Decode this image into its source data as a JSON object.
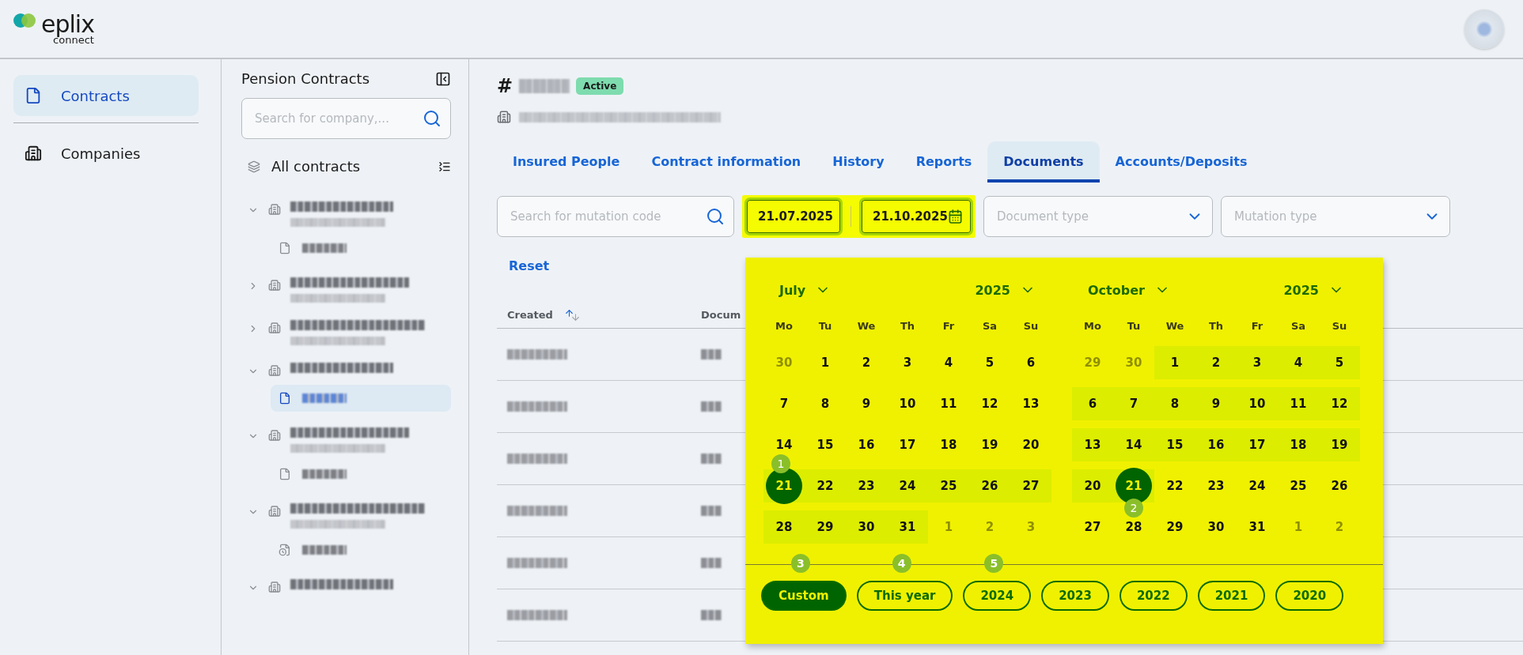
{
  "brand": {
    "name": "eplix",
    "tagline": "connect"
  },
  "nav": [
    {
      "label": "Contracts",
      "selected": true
    },
    {
      "label": "Companies",
      "selected": false
    }
  ],
  "tree_panel": {
    "title": "Pension Contracts",
    "search": {
      "placeholder": "Search for company,..."
    },
    "root": {
      "label": "All contracts"
    },
    "items": [
      {
        "expanded": true,
        "subline": true,
        "children": [
          {
            "kind": "contract",
            "selected": false
          }
        ]
      },
      {
        "expanded": false,
        "subline": true
      },
      {
        "expanded": false,
        "subline": true
      },
      {
        "expanded": true,
        "subline": false,
        "children": [
          {
            "kind": "contract",
            "selected": true
          }
        ]
      },
      {
        "expanded": true,
        "subline": true,
        "children": [
          {
            "kind": "contract",
            "selected": false
          }
        ]
      },
      {
        "expanded": true,
        "subline": true,
        "children": [
          {
            "kind": "pending",
            "selected": false
          }
        ]
      },
      {
        "expanded": true,
        "subline": false
      }
    ]
  },
  "contract": {
    "number_prefix": "#",
    "status": "Active"
  },
  "tabs": [
    {
      "label": "Insured People",
      "selected": false
    },
    {
      "label": "Contract information",
      "selected": false
    },
    {
      "label": "History",
      "selected": false
    },
    {
      "label": "Reports",
      "selected": false
    },
    {
      "label": "Documents",
      "selected": true
    },
    {
      "label": "Accounts/Deposits",
      "selected": false
    }
  ],
  "filters": {
    "search": {
      "placeholder": "Search for mutation code"
    },
    "date_from": {
      "value": "21.07.2025"
    },
    "date_to": {
      "value": "21.10.2025"
    },
    "document_type": {
      "placeholder": "Document type"
    },
    "mutation_type": {
      "placeholder": "Mutation type"
    },
    "reset": "Reset"
  },
  "table": {
    "columns": [
      {
        "label": "Created",
        "sortable": true
      },
      {
        "label": "Docum",
        "sortable": false
      }
    ],
    "rows": [
      {
        "kind": "redacted"
      },
      {
        "kind": "redacted"
      },
      {
        "kind": "redacted"
      },
      {
        "kind": "redacted"
      },
      {
        "kind": "redacted"
      },
      {
        "kind": "redacted"
      }
    ]
  },
  "date_picker": {
    "months": [
      {
        "month": "July",
        "year": "2025",
        "weekdays": [
          "Mo",
          "Tu",
          "We",
          "Th",
          "Fr",
          "Sa",
          "Su"
        ],
        "weeks": [
          [
            {
              "d": "30",
              "outside": true,
              "in_range": false,
              "selected": false
            },
            {
              "d": "1",
              "outside": false,
              "in_range": false,
              "selected": false
            },
            {
              "d": "2",
              "outside": false,
              "in_range": false,
              "selected": false
            },
            {
              "d": "3",
              "outside": false,
              "in_range": false,
              "selected": false
            },
            {
              "d": "4",
              "outside": false,
              "in_range": false,
              "selected": false
            },
            {
              "d": "5",
              "outside": false,
              "in_range": false,
              "selected": false
            },
            {
              "d": "6",
              "outside": false,
              "in_range": false,
              "selected": false
            }
          ],
          [
            {
              "d": "7",
              "outside": false,
              "in_range": false,
              "selected": false
            },
            {
              "d": "8",
              "outside": false,
              "in_range": false,
              "selected": false
            },
            {
              "d": "9",
              "outside": false,
              "in_range": false,
              "selected": false
            },
            {
              "d": "10",
              "outside": false,
              "in_range": false,
              "selected": false
            },
            {
              "d": "11",
              "outside": false,
              "in_range": false,
              "selected": false
            },
            {
              "d": "12",
              "outside": false,
              "in_range": false,
              "selected": false
            },
            {
              "d": "13",
              "outside": false,
              "in_range": false,
              "selected": false
            }
          ],
          [
            {
              "d": "14",
              "outside": false,
              "in_range": false,
              "selected": false
            },
            {
              "d": "15",
              "outside": false,
              "in_range": false,
              "selected": false
            },
            {
              "d": "16",
              "outside": false,
              "in_range": false,
              "selected": false
            },
            {
              "d": "17",
              "outside": false,
              "in_range": false,
              "selected": false
            },
            {
              "d": "18",
              "outside": false,
              "in_range": false,
              "selected": false
            },
            {
              "d": "19",
              "outside": false,
              "in_range": false,
              "selected": false
            },
            {
              "d": "20",
              "outside": false,
              "in_range": false,
              "selected": false
            }
          ],
          [
            {
              "d": "21",
              "outside": false,
              "in_range": true,
              "selected": true,
              "marker": "1"
            },
            {
              "d": "22",
              "outside": false,
              "in_range": true,
              "selected": false
            },
            {
              "d": "23",
              "outside": false,
              "in_range": true,
              "selected": false
            },
            {
              "d": "24",
              "outside": false,
              "in_range": true,
              "selected": false
            },
            {
              "d": "25",
              "outside": false,
              "in_range": true,
              "selected": false
            },
            {
              "d": "26",
              "outside": false,
              "in_range": true,
              "selected": false
            },
            {
              "d": "27",
              "outside": false,
              "in_range": true,
              "selected": false
            }
          ],
          [
            {
              "d": "28",
              "outside": false,
              "in_range": true,
              "selected": false
            },
            {
              "d": "29",
              "outside": false,
              "in_range": true,
              "selected": false
            },
            {
              "d": "30",
              "outside": false,
              "in_range": true,
              "selected": false
            },
            {
              "d": "31",
              "outside": false,
              "in_range": true,
              "selected": false
            },
            {
              "d": "1",
              "outside": true,
              "in_range": false,
              "selected": false
            },
            {
              "d": "2",
              "outside": true,
              "in_range": false,
              "selected": false
            },
            {
              "d": "3",
              "outside": true,
              "in_range": false,
              "selected": false
            }
          ]
        ]
      },
      {
        "month": "October",
        "year": "2025",
        "weekdays": [
          "Mo",
          "Tu",
          "We",
          "Th",
          "Fr",
          "Sa",
          "Su"
        ],
        "weeks": [
          [
            {
              "d": "29",
              "outside": true,
              "in_range": false,
              "selected": false
            },
            {
              "d": "30",
              "outside": true,
              "in_range": false,
              "selected": false
            },
            {
              "d": "1",
              "outside": false,
              "in_range": true,
              "selected": false
            },
            {
              "d": "2",
              "outside": false,
              "in_range": true,
              "selected": false
            },
            {
              "d": "3",
              "outside": false,
              "in_range": true,
              "selected": false
            },
            {
              "d": "4",
              "outside": false,
              "in_range": true,
              "selected": false
            },
            {
              "d": "5",
              "outside": false,
              "in_range": true,
              "selected": false
            }
          ],
          [
            {
              "d": "6",
              "outside": false,
              "in_range": true,
              "selected": false
            },
            {
              "d": "7",
              "outside": false,
              "in_range": true,
              "selected": false
            },
            {
              "d": "8",
              "outside": false,
              "in_range": true,
              "selected": false
            },
            {
              "d": "9",
              "outside": false,
              "in_range": true,
              "selected": false
            },
            {
              "d": "10",
              "outside": false,
              "in_range": true,
              "selected": false
            },
            {
              "d": "11",
              "outside": false,
              "in_range": true,
              "selected": false
            },
            {
              "d": "12",
              "outside": false,
              "in_range": true,
              "selected": false
            }
          ],
          [
            {
              "d": "13",
              "outside": false,
              "in_range": true,
              "selected": false
            },
            {
              "d": "14",
              "outside": false,
              "in_range": true,
              "selected": false
            },
            {
              "d": "15",
              "outside": false,
              "in_range": true,
              "selected": false
            },
            {
              "d": "16",
              "outside": false,
              "in_range": true,
              "selected": false
            },
            {
              "d": "17",
              "outside": false,
              "in_range": true,
              "selected": false
            },
            {
              "d": "18",
              "outside": false,
              "in_range": true,
              "selected": false
            },
            {
              "d": "19",
              "outside": false,
              "in_range": true,
              "selected": false
            }
          ],
          [
            {
              "d": "20",
              "outside": false,
              "in_range": true,
              "selected": false
            },
            {
              "d": "21",
              "outside": false,
              "in_range": true,
              "selected": true,
              "marker": "2"
            },
            {
              "d": "22",
              "outside": false,
              "in_range": false,
              "selected": false
            },
            {
              "d": "23",
              "outside": false,
              "in_range": false,
              "selected": false
            },
            {
              "d": "24",
              "outside": false,
              "in_range": false,
              "selected": false
            },
            {
              "d": "25",
              "outside": false,
              "in_range": false,
              "selected": false
            },
            {
              "d": "26",
              "outside": false,
              "in_range": false,
              "selected": false
            }
          ],
          [
            {
              "d": "27",
              "outside": false,
              "in_range": false,
              "selected": false
            },
            {
              "d": "28",
              "outside": false,
              "in_range": false,
              "selected": false
            },
            {
              "d": "29",
              "outside": false,
              "in_range": false,
              "selected": false
            },
            {
              "d": "30",
              "outside": false,
              "in_range": false,
              "selected": false
            },
            {
              "d": "31",
              "outside": false,
              "in_range": false,
              "selected": false
            },
            {
              "d": "1",
              "outside": true,
              "in_range": false,
              "selected": false
            },
            {
              "d": "2",
              "outside": true,
              "in_range": false,
              "selected": false
            }
          ]
        ]
      }
    ],
    "presets": [
      {
        "label": "Custom",
        "selected": true,
        "marker": "3"
      },
      {
        "label": "This year",
        "selected": false,
        "marker": "4"
      },
      {
        "label": "2024",
        "selected": false,
        "marker": "5"
      },
      {
        "label": "2023",
        "selected": false
      },
      {
        "label": "2022",
        "selected": false
      },
      {
        "label": "2021",
        "selected": false
      },
      {
        "label": "2020",
        "selected": false
      }
    ]
  }
}
